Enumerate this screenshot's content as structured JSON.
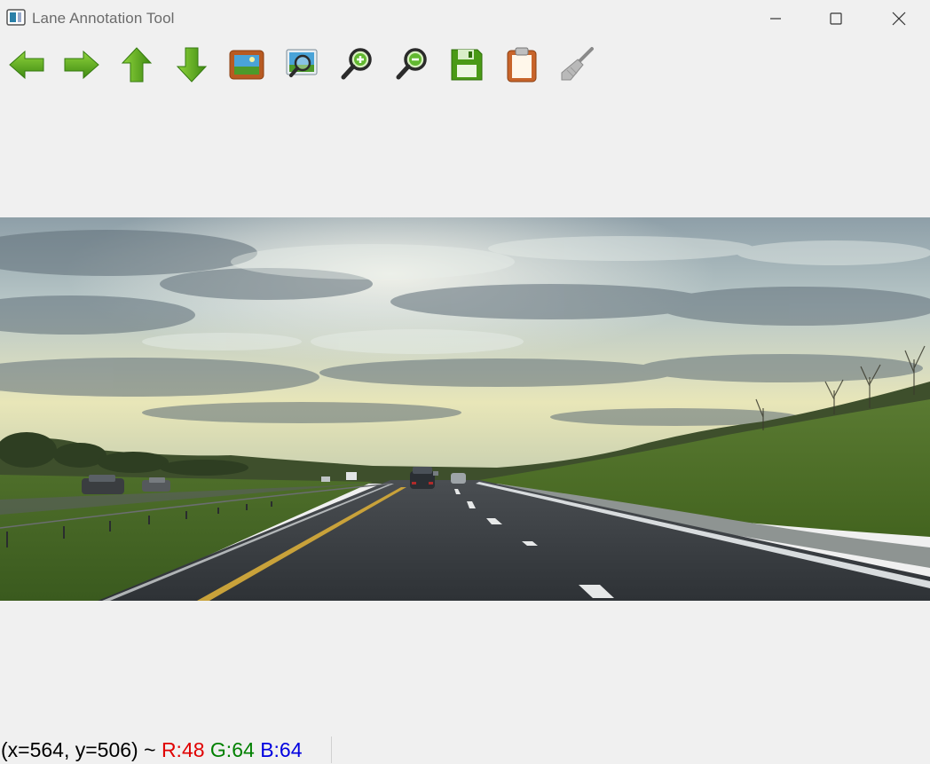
{
  "window": {
    "title": "Lane Annotation Tool",
    "controls": [
      "minimize",
      "maximize",
      "close"
    ]
  },
  "toolbar": {
    "tools": [
      {
        "name": "previous",
        "icon": "arrow-left-icon"
      },
      {
        "name": "next",
        "icon": "arrow-right-icon"
      },
      {
        "name": "up",
        "icon": "arrow-up-icon"
      },
      {
        "name": "down",
        "icon": "arrow-down-icon"
      },
      {
        "name": "open-image",
        "icon": "image-icon"
      },
      {
        "name": "fit-image",
        "icon": "zoom-fit-icon"
      },
      {
        "name": "zoom-in",
        "icon": "zoom-in-icon"
      },
      {
        "name": "zoom-out",
        "icon": "zoom-out-icon"
      },
      {
        "name": "save",
        "icon": "floppy-save-icon"
      },
      {
        "name": "clipboard",
        "icon": "clipboard-icon"
      },
      {
        "name": "clear",
        "icon": "broom-icon"
      }
    ]
  },
  "image": {
    "description_role": "highway-road-frame"
  },
  "status": {
    "coords": "(x=564, y=506) ~",
    "r": "R:48",
    "g": "G:64",
    "b": "B:64"
  },
  "colors": {
    "accent_green": "#4a9a16",
    "r": "#e00000",
    "g": "#008000",
    "b": "#0000e0"
  }
}
